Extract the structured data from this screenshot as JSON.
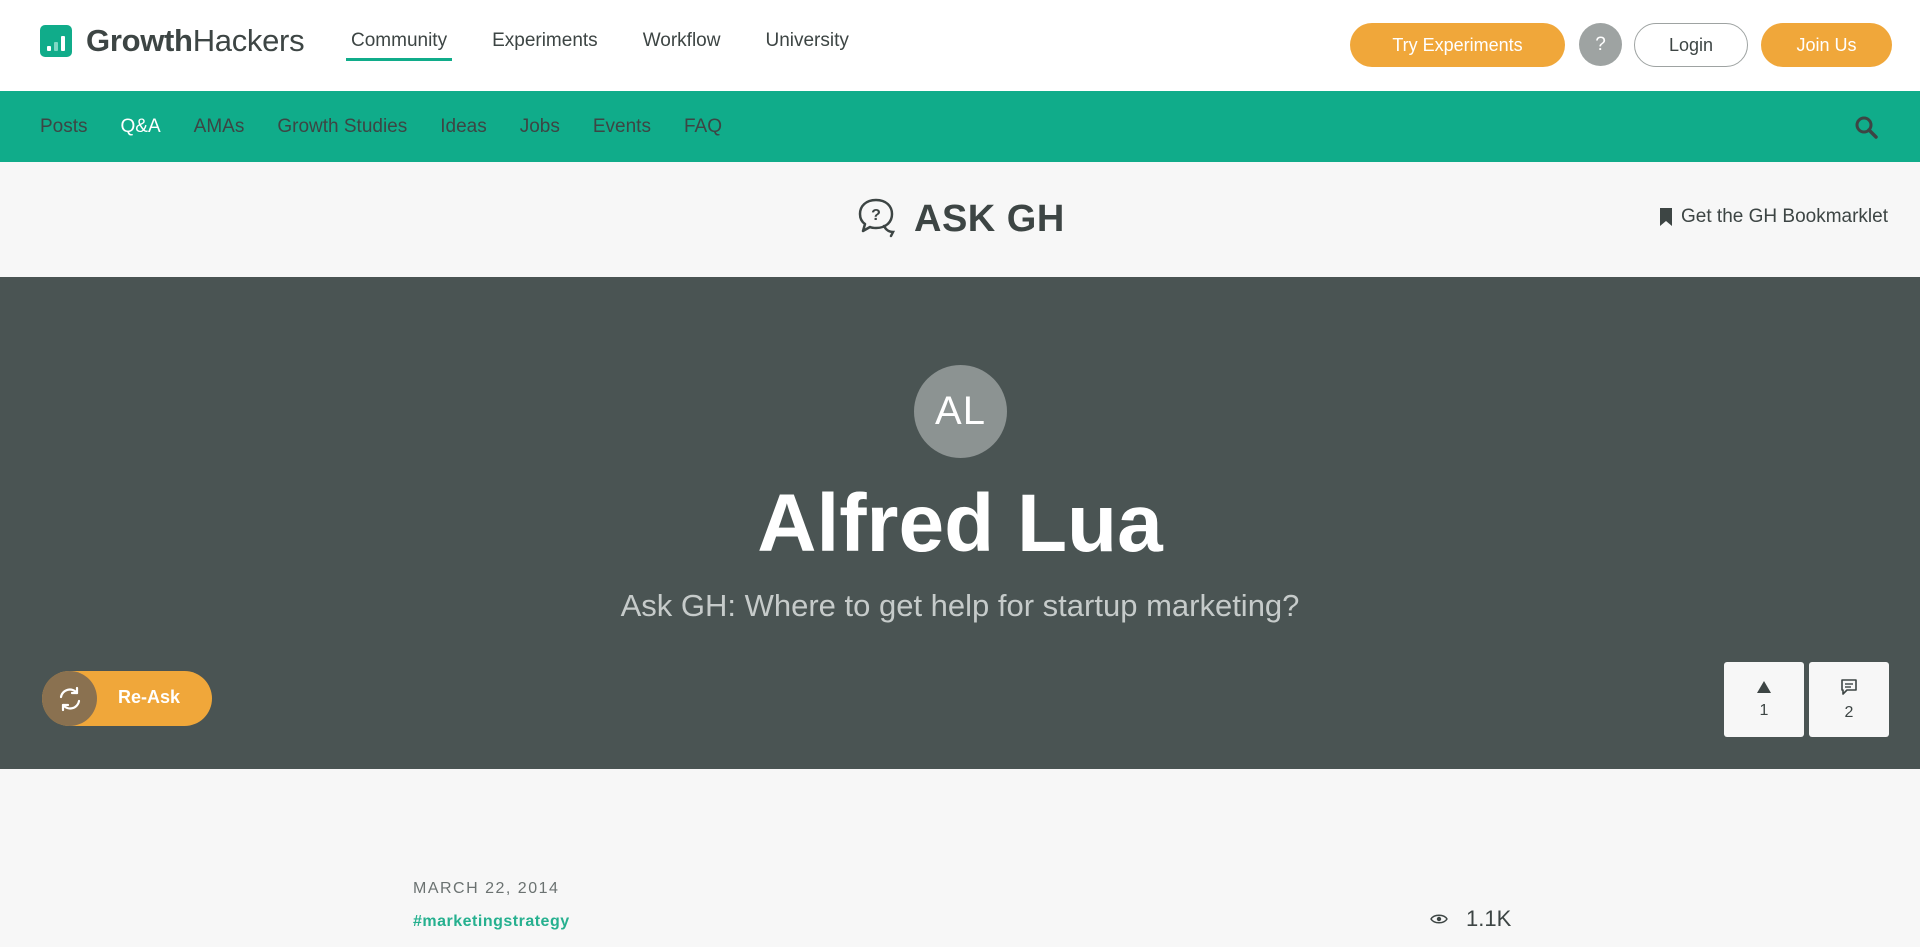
{
  "brand": {
    "name_bold": "Growth",
    "name_light": "Hackers"
  },
  "main_nav": [
    {
      "label": "Community",
      "active": true
    },
    {
      "label": "Experiments",
      "active": false
    },
    {
      "label": "Workflow",
      "active": false
    },
    {
      "label": "University",
      "active": false
    }
  ],
  "header_buttons": {
    "try": "Try Experiments",
    "help": "?",
    "login": "Login",
    "join": "Join Us"
  },
  "sub_nav": [
    {
      "label": "Posts",
      "active": false
    },
    {
      "label": "Q&A",
      "active": true
    },
    {
      "label": "AMAs",
      "active": false
    },
    {
      "label": "Growth Studies",
      "active": false
    },
    {
      "label": "Ideas",
      "active": false
    },
    {
      "label": "Jobs",
      "active": false
    },
    {
      "label": "Events",
      "active": false
    },
    {
      "label": "FAQ",
      "active": false
    }
  ],
  "section": {
    "title": "ASK GH",
    "bookmarklet": "Get the GH Bookmarklet"
  },
  "hero": {
    "initials": "AL",
    "name": "Alfred Lua",
    "question": "Ask GH: Where to get help for startup marketing?",
    "reask_label": "Re-Ask",
    "upvotes": "1",
    "comments": "2"
  },
  "post": {
    "date": "MARCH 22, 2014",
    "tag": "#marketingstrategy",
    "views": "1.1K"
  },
  "colors": {
    "brand_green": "#10ac8a",
    "accent_orange": "#f0a73a",
    "hero_bg": "#4a5453"
  },
  "icons": [
    "growthhackers-logo-icon",
    "search-icon",
    "question-bubble-icon",
    "bookmark-icon",
    "refresh-icon",
    "upvote-triangle-icon",
    "comment-icon",
    "eye-icon"
  ]
}
